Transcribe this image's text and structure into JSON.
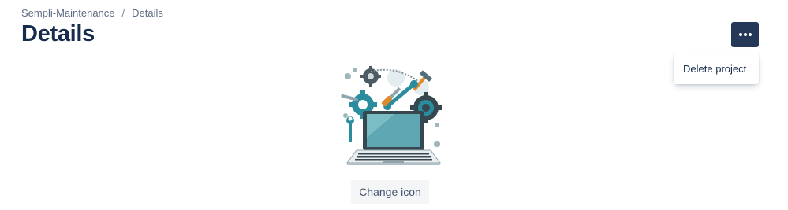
{
  "breadcrumb": {
    "items": [
      {
        "label": "Sempli-Maintenance"
      },
      {
        "label": "Details"
      }
    ],
    "separator": "/"
  },
  "header": {
    "title": "Details",
    "more_button_icon": "more-horizontal-icon"
  },
  "dropdown": {
    "items": [
      {
        "label": "Delete project"
      }
    ]
  },
  "project": {
    "icon_name": "laptop-tools-illustration",
    "change_icon_label": "Change icon"
  },
  "colors": {
    "title": "#172b4d",
    "breadcrumb": "#5e6c84",
    "more_button_bg": "#253858",
    "button_bg": "#f4f5f7",
    "illustration_teal": "#2a8c9c",
    "illustration_dark": "#37474f"
  }
}
